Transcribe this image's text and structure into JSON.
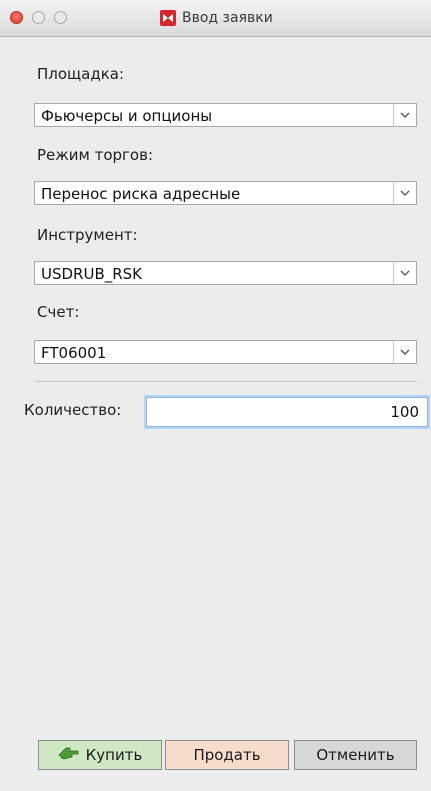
{
  "window": {
    "title": "Ввод заявки",
    "app_icon": "moex-logo-icon"
  },
  "form": {
    "venue": {
      "label": "Площадка:",
      "value": "Фьючерсы и опционы"
    },
    "mode": {
      "label": "Режим торгов:",
      "value": "Перенос риска адресные"
    },
    "instrument": {
      "label": "Инструмент:",
      "value": "USDRUB_RSK"
    },
    "account": {
      "label": "Счет:",
      "value": "FT06001"
    },
    "quantity": {
      "label": "Количество:",
      "value": "100"
    }
  },
  "buttons": {
    "buy": "Купить",
    "sell": "Продать",
    "cancel": "Отменить"
  },
  "colors": {
    "buy_bg": "#cfe8c3",
    "sell_bg": "#f6dcca",
    "cancel_bg": "#d7d7d7",
    "logo_red": "#d3262f"
  }
}
